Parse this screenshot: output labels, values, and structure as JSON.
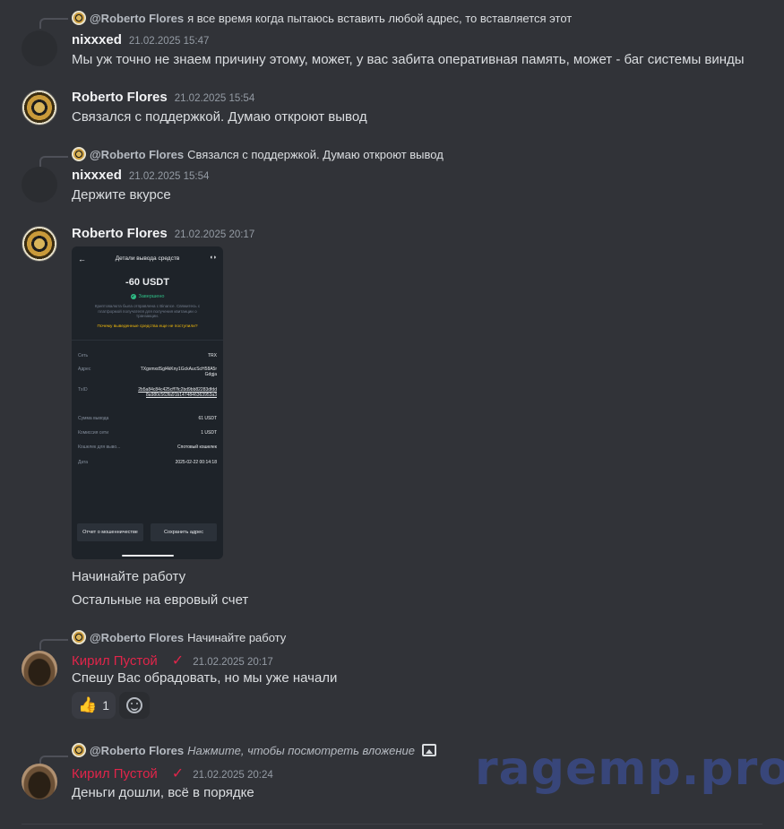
{
  "messages": [
    {
      "reply": {
        "name": "@Roberto Flores",
        "text": "я все время когда пытаюсь вставить любой адрес, то вставляется этот"
      },
      "author": "nixxxed",
      "timestamp": "21.02.2025 15:47",
      "lines": [
        "Мы уж точно не знаем причину этому, может, у вас забита оперативная память, может - баг системы винды"
      ]
    },
    {
      "author": "Roberto Flores",
      "timestamp": "21.02.2025 15:54",
      "lines": [
        "Связался с поддержкой. Думаю откроют вывод"
      ]
    },
    {
      "reply": {
        "name": "@Roberto Flores",
        "text": "Связался с поддержкой. Думаю откроют вывод"
      },
      "author": "nixxxed",
      "timestamp": "21.02.2025 15:54",
      "lines": [
        "Держите вкурсе"
      ]
    },
    {
      "author": "Roberto Flores",
      "timestamp": "21.02.2025 20:17",
      "attachment": {
        "title": "Детали вывода средств",
        "amount": "-60 USDT",
        "status": "Завершено",
        "note": "Криптовалюта была отправлена с Binance. Свяжитесь с платформой получателя для получения квитанции о транзакции.",
        "why": "Почему выведенные средства еще не поступили?",
        "rows": [
          {
            "k": "Сеть",
            "v": "TRX"
          },
          {
            "k": "Адрес",
            "v": "TXgxmxdSgl4kKny1GckAucScH58A5rGdgja"
          },
          {
            "k": "TxID",
            "v": "2b5a84c84c425cff7fc2bd9bb82283dfdd8a980c563fa91b1474846363953a3"
          },
          {
            "k": "Сумма вывода",
            "v": "61 USDT"
          },
          {
            "k": "Комиссия сети",
            "v": "1 USDT"
          },
          {
            "k": "Кошелек для выво...",
            "v": "Спотовый кошелек"
          },
          {
            "k": "Дата",
            "v": "2025-02-22 00:14:18"
          }
        ],
        "btn_report": "Отчет о мошенничестве",
        "btn_save": "Сохранить адрес"
      },
      "lines": [
        "Начинайте работу",
        "Остальные на евровый счет"
      ]
    },
    {
      "reply": {
        "name": "@Roberto Flores",
        "text": "Начинайте работу"
      },
      "author": "Кирил Пустой",
      "timestamp": "21.02.2025 20:17",
      "lines": [
        "Спешу Вас обрадовать, но мы уже начали"
      ],
      "reactions": [
        {
          "emoji": "👍",
          "count": "1"
        }
      ]
    },
    {
      "reply": {
        "name": "@Roberto Flores",
        "text": "Нажмите, чтобы посмотреть вложение"
      },
      "author": "Кирил Пустой",
      "timestamp": "21.02.2025 20:24",
      "lines": [
        "Деньги дошли, всё в порядке"
      ]
    }
  ],
  "watermark": "ragemp.pro",
  "colors": {
    "background": "#313338",
    "role_red": "#e0254a",
    "success": "#2ebd85",
    "warning": "#f0b90b"
  },
  "icons": {
    "check": "checkmark-icon",
    "reaction_add": "add-reaction-icon",
    "image": "image-icon"
  }
}
